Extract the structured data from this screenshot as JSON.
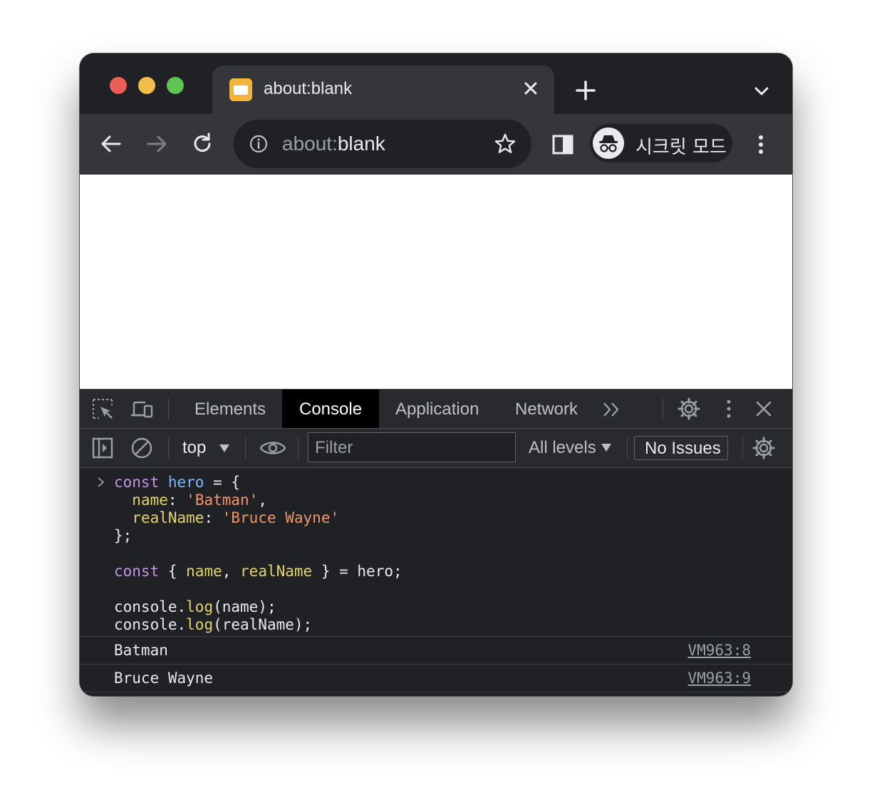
{
  "tab": {
    "title": "about:blank"
  },
  "omnibox": {
    "url_scheme": "about:",
    "url_host": "blank"
  },
  "profile": {
    "label": "시크릿 모드"
  },
  "devtools": {
    "tabs": [
      "Elements",
      "Console",
      "Application",
      "Network"
    ],
    "active_tab": "Console",
    "context": "top",
    "filter_placeholder": "Filter",
    "levels": "All levels",
    "issues": "No Issues"
  },
  "console": {
    "input_lines": [
      [
        {
          "t": "const ",
          "c": "kw"
        },
        {
          "t": "hero",
          "c": "var"
        },
        {
          "t": " = {",
          "c": ""
        }
      ],
      [
        {
          "t": "  ",
          "c": ""
        },
        {
          "t": "name",
          "c": "prop"
        },
        {
          "t": ": ",
          "c": ""
        },
        {
          "t": "'Batman'",
          "c": "str"
        },
        {
          "t": ",",
          "c": ""
        }
      ],
      [
        {
          "t": "  ",
          "c": ""
        },
        {
          "t": "realName",
          "c": "prop"
        },
        {
          "t": ": ",
          "c": ""
        },
        {
          "t": "'Bruce Wayne'",
          "c": "str"
        }
      ],
      [
        {
          "t": "};",
          "c": ""
        }
      ],
      [],
      [
        {
          "t": "const",
          "c": "kw"
        },
        {
          "t": " { ",
          "c": ""
        },
        {
          "t": "name",
          "c": "prop"
        },
        {
          "t": ", ",
          "c": ""
        },
        {
          "t": "realName",
          "c": "prop"
        },
        {
          "t": " } = hero;",
          "c": ""
        }
      ],
      [],
      [
        {
          "t": "console.",
          "c": ""
        },
        {
          "t": "log",
          "c": "fn"
        },
        {
          "t": "(name);",
          "c": ""
        }
      ],
      [
        {
          "t": "console.",
          "c": ""
        },
        {
          "t": "log",
          "c": "fn"
        },
        {
          "t": "(realName);",
          "c": ""
        }
      ]
    ],
    "logs": [
      {
        "text": "Batman",
        "source": "VM963:8"
      },
      {
        "text": "Bruce Wayne",
        "source": "VM963:9"
      }
    ]
  },
  "colors": {
    "tab_bg": "#35363a",
    "frame_bg": "#202124",
    "devtools_bg": "#202124",
    "keyword": "#c792ea",
    "string": "#f29668",
    "property": "#e5d36b",
    "variable": "#79b8ff"
  },
  "icons": [
    "close-icon",
    "plus-icon",
    "chevron-down-icon",
    "back-icon",
    "forward-icon",
    "reload-icon",
    "info-icon",
    "star-icon",
    "side-panel-icon",
    "incognito-icon",
    "kebab-menu-icon",
    "inspect-icon",
    "device-icon",
    "more-tabs-icon",
    "gear-icon",
    "sidebar-toggle-icon",
    "clear-icon",
    "eye-icon"
  ]
}
